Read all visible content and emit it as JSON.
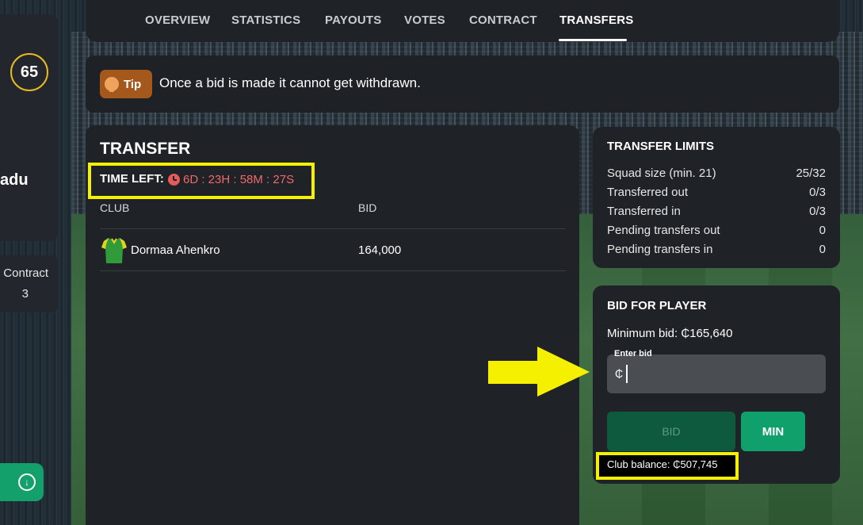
{
  "sidebar": {
    "rating": "65",
    "player_name_partial": "adu",
    "contract_label": "Contract",
    "contract_value": "3"
  },
  "nav": {
    "tabs": [
      {
        "label": "OVERVIEW"
      },
      {
        "label": "STATISTICS"
      },
      {
        "label": "PAYOUTS"
      },
      {
        "label": "VOTES"
      },
      {
        "label": "CONTRACT"
      },
      {
        "label": "TRANSFERS",
        "active": true
      }
    ]
  },
  "tip": {
    "badge": "Tip",
    "text": "Once a bid is made it cannot get withdrawn."
  },
  "transfer": {
    "title": "TRANSFER",
    "time_left_label": "TIME LEFT:",
    "time_left_value": "6D : 23H : 58M : 27S",
    "columns": {
      "club": "CLUB",
      "bid": "BID"
    },
    "rows": [
      {
        "club": "Dormaa Ahenkro",
        "bid": "164,000"
      }
    ]
  },
  "limits": {
    "title": "TRANSFER LIMITS",
    "rows": [
      {
        "label": "Squad size (min. 21)",
        "value": "25/32"
      },
      {
        "label": "Transferred out",
        "value": "0/3"
      },
      {
        "label": "Transferred in",
        "value": "0/3"
      },
      {
        "label": "Pending transfers out",
        "value": "0"
      },
      {
        "label": "Pending transfers in",
        "value": "0"
      }
    ]
  },
  "bid_panel": {
    "title": "BID FOR PLAYER",
    "minimum_bid": "Minimum bid: ₵165,640",
    "input_label": "Enter bid",
    "input_prefix": "₵",
    "input_value": "",
    "bid_button": "BID",
    "min_button": "MIN",
    "club_balance": "Club balance: ₵507,745"
  },
  "colors": {
    "accent_green": "#10a06c",
    "timer_red": "#ef6a6a",
    "highlight_yellow": "#f5f000",
    "rating_ring": "#e8b923"
  },
  "icons": [
    "clock-icon",
    "lightbulb-icon",
    "download-icon",
    "jersey-icon",
    "arrow-right-icon"
  ]
}
